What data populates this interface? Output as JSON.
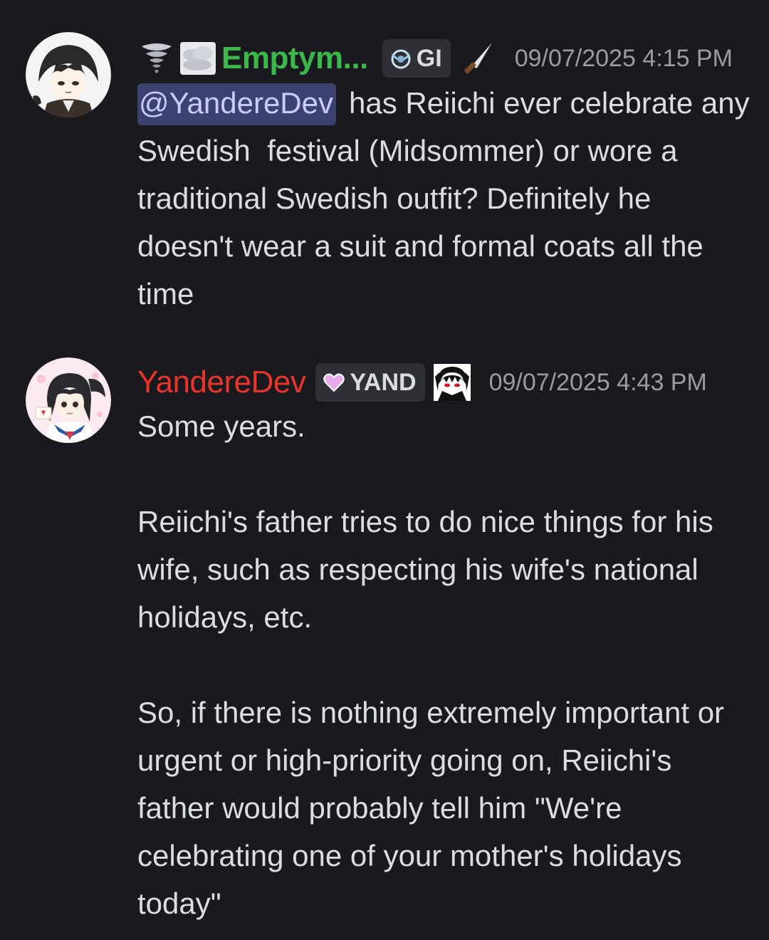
{
  "messages": [
    {
      "username": "Emptym...",
      "tag_label": "GI",
      "timestamp": "09/07/2025 4:15 PM",
      "mention": "@YandereDev",
      "text": "has Reiichi ever celebrate any Swedish  festival (Midsommer) or wore a traditional Swedish outfit? Definitely he doesn't wear a suit and formal coats all the time",
      "name_color": "#3cb84a"
    },
    {
      "username": "YandereDev",
      "tag_label": "YAND",
      "timestamp": "09/07/2025 4:43 PM",
      "text": "Some years.\n\nReiichi's father tries to do nice things for his wife, such as respecting his wife's national holidays, etc.\n\nSo, if there is nothing extremely important or urgent or high-priority going on, Reiichi's father would probably tell him \"We're celebrating one of your mother's holidays today\"",
      "name_color": "#e8352c"
    }
  ],
  "colors": {
    "background": "#1a1a1e",
    "text": "#dbdee1",
    "timestamp": "#9a9ca3",
    "mention_bg": "#3c4270",
    "mention_text": "#c9cdfb",
    "tag_bg": "#2e3035"
  },
  "icons": {
    "msg1_emojis": [
      "tornado-icon",
      "fog-icon"
    ],
    "msg1_tag_icon": "genshin-icon",
    "msg1_role_icon": "knife-icon",
    "msg2_tag_icon": "heart-icon",
    "msg2_role_icon": "vampire-portrait-icon"
  }
}
